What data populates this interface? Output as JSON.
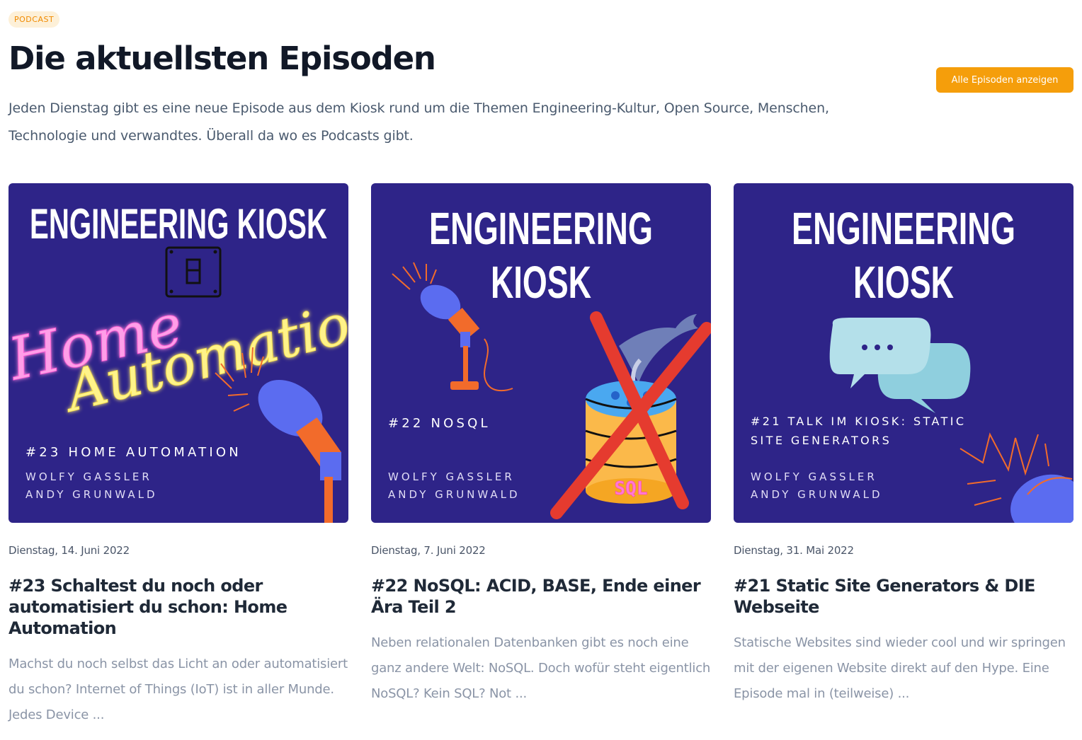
{
  "header": {
    "badge": "PODCAST",
    "title": "Die aktuellsten Episoden",
    "intro": "Jeden Dienstag gibt es eine neue Episode aus dem Kiosk rund um die Themen Engineering-Kultur, Open Source, Menschen, Technologie und verwandtes. Überall da wo es Podcasts gibt.",
    "all_button": "Alle Episoden anzeigen"
  },
  "colors": {
    "accent": "#f59e0b",
    "cover_bg": "#2e2488",
    "cover_text": "#ffffff"
  },
  "episodes": [
    {
      "date": "Dienstag, 14. Juni 2022",
      "title": "#23 Schaltest du noch oder automatisiert du schon: Home Automation",
      "description": "Machst du noch selbst das Licht an oder automatisiert du schon? Internet of Things (IoT) ist in aller Munde. Jedes Device ...",
      "cover": {
        "brand": "ENGINEERING KIOSK",
        "neon_1": "Home",
        "neon_2": "Automation",
        "episode": "#23 HOME AUTOMATION",
        "host_1": "WOLFY GASSLER",
        "host_2": "ANDY GRUNWALD",
        "icons": [
          "light-switch-icon",
          "microphone-icon"
        ]
      }
    },
    {
      "date": "Dienstag, 7. Juni 2022",
      "title": "#22 NoSQL: ACID, BASE, Ende einer Ära Teil 2",
      "description": "Neben relationalen Datenbanken gibt es noch eine ganz andere Welt: NoSQL. Doch wofür steht eigentlich NoSQL? Kein SQL? Not ...",
      "cover": {
        "brand_1": "ENGINEERING",
        "brand_2": "KIOSK",
        "episode": "#22 NOSQL",
        "host_1": "WOLFY GASSLER",
        "host_2": "ANDY GRUNWALD",
        "db_label": "SQL",
        "icons": [
          "microphone-icon",
          "database-icon",
          "dolphin-icon",
          "red-cross-icon"
        ]
      }
    },
    {
      "date": "Dienstag, 31. Mai 2022",
      "title": "#21 Static Site Generators & DIE Webseite",
      "description": "Statische Websites sind wieder cool und wir springen mit der eigenen Website direkt auf den Hype. Eine Episode mal in (teilweise) ...",
      "cover": {
        "brand_1": "ENGINEERING",
        "brand_2": "KIOSK",
        "episode_1": "#21 TALK IM KIOSK: STATIC",
        "episode_2": "SITE GENERATORS",
        "host_1": "WOLFY GASSLER",
        "host_2": "ANDY GRUNWALD",
        "icons": [
          "speech-bubbles-icon",
          "microphone-icon"
        ]
      }
    }
  ]
}
